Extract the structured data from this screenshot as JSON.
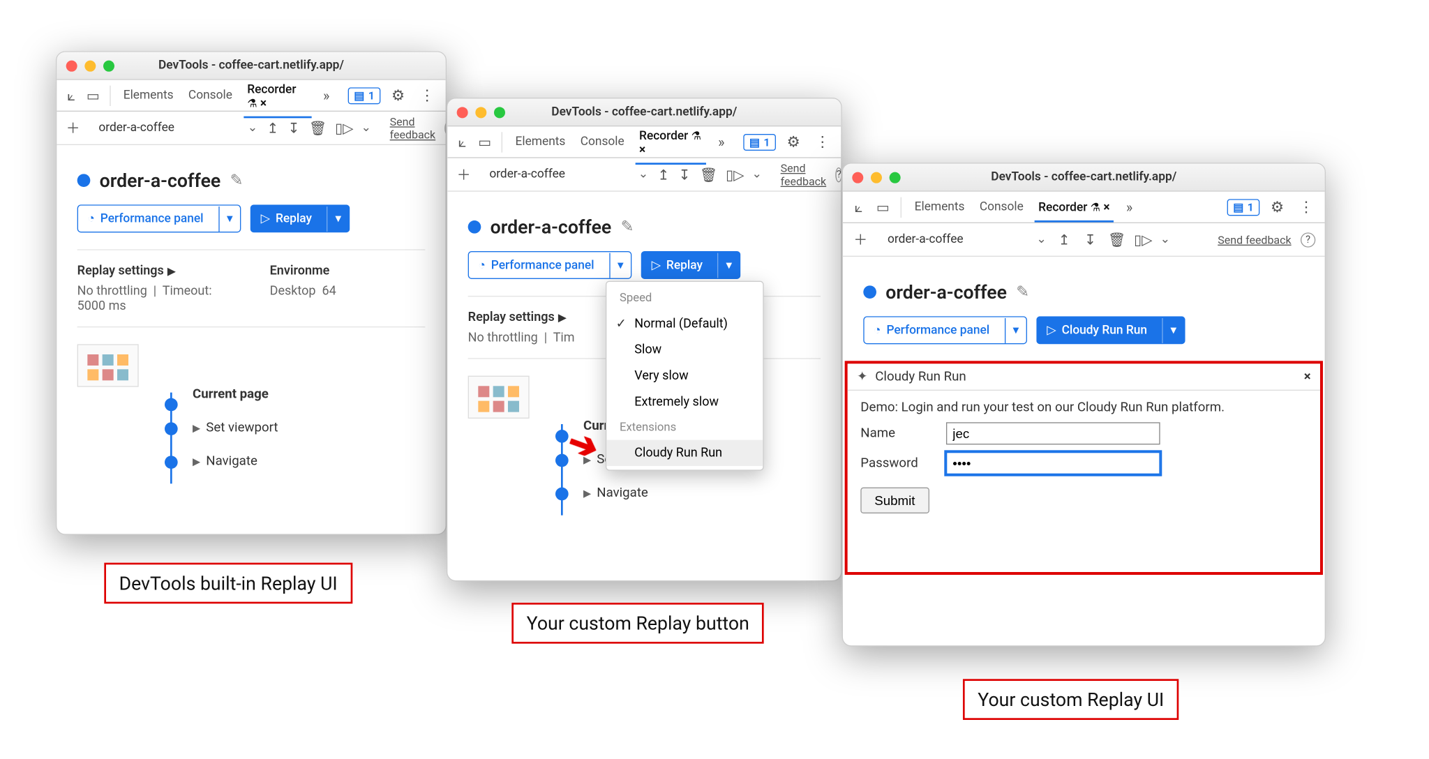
{
  "window_title": "DevTools - coffee-cart.netlify.app/",
  "tabs": {
    "elements": "Elements",
    "console": "Console",
    "recorder": "Recorder"
  },
  "badge_count": "1",
  "recording_name": "order-a-coffee",
  "feedback": "Send feedback",
  "heading": "order-a-coffee",
  "perf_panel": "Performance panel",
  "replay": "Replay",
  "cloudy_btn": "Cloudy Run Run",
  "settings": {
    "replay_hd": "Replay settings",
    "throttle": "No throttling",
    "timeout": "Timeout: 5000 ms",
    "env_hd": "Environment",
    "env_val": "Desktop",
    "env_extra": "64"
  },
  "steps": {
    "s1": "Current page",
    "s2": "Set viewport",
    "s3": "Navigate"
  },
  "dropdown": {
    "speed": "Speed",
    "normal": "Normal (Default)",
    "slow": "Slow",
    "veryslow": "Very slow",
    "extreme": "Extremely slow",
    "ext": "Extensions",
    "cloudy": "Cloudy Run Run"
  },
  "ext_panel": {
    "title": "Cloudy Run Run",
    "desc": "Demo: Login and run your test on our Cloudy Run Run platform.",
    "name_lbl": "Name",
    "name_val": "jec",
    "pass_lbl": "Password",
    "pass_val": "••••",
    "submit": "Submit"
  },
  "captions": {
    "c1": "DevTools built-in Replay UI",
    "c2": "Your custom Replay button",
    "c3": "Your custom Replay UI"
  }
}
